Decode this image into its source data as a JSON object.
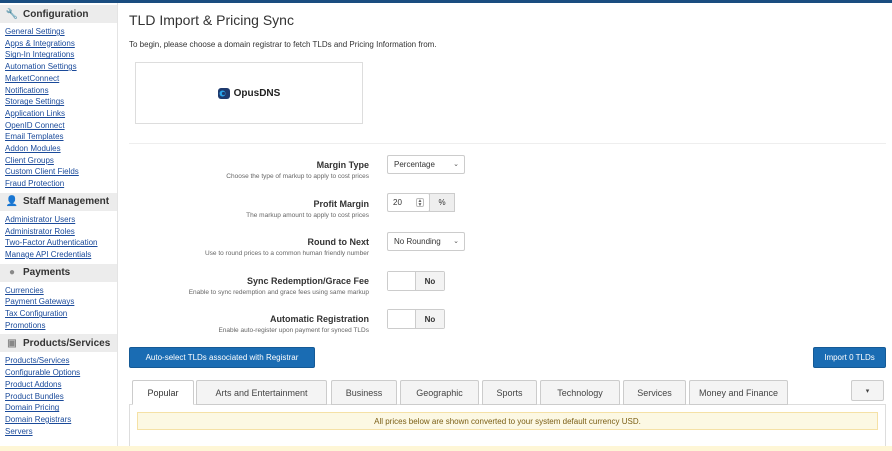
{
  "sidebar": {
    "sections": [
      {
        "title": "Configuration",
        "icon": "wrench-icon",
        "links": [
          "General Settings",
          "Apps & Integrations",
          "Sign-In Integrations",
          "Automation Settings",
          "MarketConnect",
          "Notifications",
          "Storage Settings",
          "Application Links",
          "OpenID Connect",
          "Email Templates",
          "Addon Modules",
          "Client Groups",
          "Custom Client Fields",
          "Fraud Protection"
        ]
      },
      {
        "title": "Staff Management",
        "icon": "user-icon",
        "links": [
          "Administrator Users",
          "Administrator Roles",
          "Two-Factor Authentication",
          "Manage API Credentials"
        ]
      },
      {
        "title": "Payments",
        "icon": "coin-icon",
        "links": [
          "Currencies",
          "Payment Gateways",
          "Tax Configuration",
          "Promotions"
        ]
      },
      {
        "title": "Products/Services",
        "icon": "cube-icon",
        "links": [
          "Products/Services",
          "Configurable Options",
          "Product Addons",
          "Product Bundles",
          "Domain Pricing",
          "Domain Registrars",
          "Servers"
        ]
      }
    ]
  },
  "main": {
    "title": "TLD Import & Pricing Sync",
    "intro": "To begin, please choose a domain registrar to fetch TLDs and Pricing Information from.",
    "registrar": {
      "name": "OpusDNS"
    },
    "settings": {
      "margin_type": {
        "label": "Margin Type",
        "desc": "Choose the type of markup to apply to cost prices",
        "value": "Percentage"
      },
      "profit_margin": {
        "label": "Profit Margin",
        "desc": "The markup amount to apply to cost prices",
        "value": "20",
        "unit": "%"
      },
      "round_to_next": {
        "label": "Round to Next",
        "desc": "Use to round prices to a common human friendly number",
        "value": "No Rounding"
      },
      "sync_redemption": {
        "label": "Sync Redemption/Grace Fee",
        "desc": "Enable to sync redemption and grace fees using same markup",
        "value": "No"
      },
      "auto_registration": {
        "label": "Automatic Registration",
        "desc": "Enable auto-register upon payment for synced TLDs",
        "value": "No"
      }
    },
    "buttons": {
      "auto_select": "Auto-select TLDs associated with Registrar",
      "import": "Import 0 TLDs"
    },
    "tabs": [
      "Popular",
      "Arts and Entertainment",
      "Business",
      "Geographic",
      "Sports",
      "Technology",
      "Services",
      "Money and Finance"
    ],
    "notice": "All prices below are shown converted to your system default currency USD."
  },
  "colors": {
    "primary": "#1a6cb3",
    "link": "#1a4a9a",
    "notice_bg": "#fcf8e3"
  }
}
